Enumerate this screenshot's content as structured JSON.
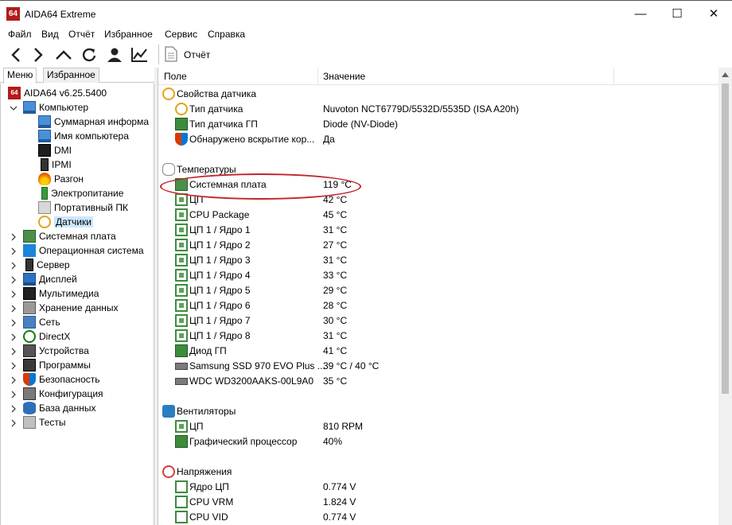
{
  "window": {
    "app_icon_text": "64",
    "title": "AIDA64 Extreme",
    "minimize_glyph": "—",
    "maximize_glyph": "☐",
    "close_glyph": "✕"
  },
  "menu": [
    "Файл",
    "Вид",
    "Отчёт",
    "Избранное",
    "Сервис",
    "Справка"
  ],
  "toolbar": {
    "icons": [
      "back-icon",
      "forward-icon",
      "up-icon",
      "refresh-icon",
      "user-icon",
      "chart-icon"
    ],
    "report_label": "Отчёт"
  },
  "left_tabs": {
    "menu": "Меню",
    "favorites": "Избранное"
  },
  "tree": {
    "root": "AIDA64 v6.25.5400",
    "computer": "Компьютер",
    "computer_children": [
      "Суммарная информа",
      "Имя компьютера",
      "DMI",
      "IPMI",
      "Разгон",
      "Электропитание",
      "Портативный ПК",
      "Датчики"
    ],
    "categories": [
      "Системная плата",
      "Операционная система",
      "Сервер",
      "Дисплей",
      "Мультимедиа",
      "Хранение данных",
      "Сеть",
      "DirectX",
      "Устройства",
      "Программы",
      "Безопасность",
      "Конфигурация",
      "База данных",
      "Тесты"
    ]
  },
  "list_header": {
    "field": "Поле",
    "value": "Значение"
  },
  "sections": {
    "sensor_props": {
      "title": "Свойства датчика",
      "rows": [
        {
          "field": "Тип датчика",
          "value": "Nuvoton NCT6779D/5532D/5535D  (ISA A20h)"
        },
        {
          "field": "Тип датчика ГП",
          "value": "Diode  (NV-Diode)"
        },
        {
          "field": "Обнаружено вскрытие кор...",
          "value": "Да"
        }
      ]
    },
    "temps": {
      "title": "Температуры",
      "rows": [
        {
          "field": "Системная плата",
          "value": "119 °C"
        },
        {
          "field": "ЦП",
          "value": "42 °C"
        },
        {
          "field": "CPU Package",
          "value": "45 °C"
        },
        {
          "field": "ЦП 1 / Ядро 1",
          "value": "31 °C"
        },
        {
          "field": "ЦП 1 / Ядро 2",
          "value": "27 °C"
        },
        {
          "field": "ЦП 1 / Ядро 3",
          "value": "31 °C"
        },
        {
          "field": "ЦП 1 / Ядро 4",
          "value": "33 °C"
        },
        {
          "field": "ЦП 1 / Ядро 5",
          "value": "29 °C"
        },
        {
          "field": "ЦП 1 / Ядро 6",
          "value": "28 °C"
        },
        {
          "field": "ЦП 1 / Ядро 7",
          "value": "30 °C"
        },
        {
          "field": "ЦП 1 / Ядро 8",
          "value": "31 °C"
        },
        {
          "field": "Диод ГП",
          "value": "41 °C"
        },
        {
          "field": "Samsung SSD 970 EVO Plus ...",
          "value": "39 °C / 40 °C"
        },
        {
          "field": "WDC WD3200AAKS-00L9A0",
          "value": "35 °C"
        }
      ]
    },
    "fans": {
      "title": "Вентиляторы",
      "rows": [
        {
          "field": "ЦП",
          "value": "810 RPM"
        },
        {
          "field": "Графический процессор",
          "value": "40%"
        }
      ]
    },
    "volts": {
      "title": "Напряжения",
      "rows": [
        {
          "field": "Ядро ЦП",
          "value": "0.774 V"
        },
        {
          "field": "CPU VRM",
          "value": "1.824 V"
        },
        {
          "field": "CPU VID",
          "value": "0.774 V"
        }
      ]
    }
  },
  "colors": {
    "highlight_ellipse": "#c0262d",
    "selection": "#cce8ff",
    "app_icon": "#b31b1b"
  }
}
